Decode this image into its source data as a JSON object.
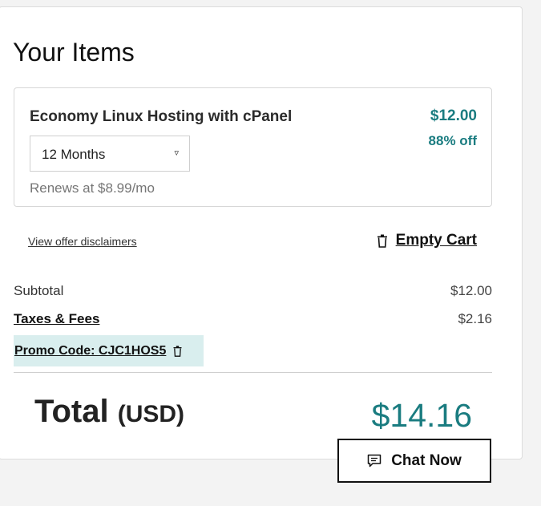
{
  "cart": {
    "title": "Your Items",
    "item": {
      "name": "Economy Linux Hosting with cPanel",
      "price": "$12.00",
      "discount": "88% off",
      "term": "12 Months",
      "renewal": "Renews at $8.99/mo"
    },
    "disclaimers_link": "View offer disclaimers",
    "empty_cart_label": "Empty Cart"
  },
  "summary": {
    "subtotal_label": "Subtotal",
    "subtotal_value": "$12.00",
    "taxes_label": "Taxes & Fees",
    "taxes_value": "$2.16",
    "promo_label": "Promo Code: CJC1HOS5",
    "total_label": "Total",
    "total_currency": "(USD)",
    "total_value": "$14.16"
  },
  "chat": {
    "label": "Chat Now"
  },
  "icons": {
    "trash": "trash-icon",
    "chat": "chat-bubble-icon",
    "caret": "caret-down-icon"
  },
  "colors": {
    "accent": "#1a7c80",
    "promo_background": "#d9eeee"
  }
}
